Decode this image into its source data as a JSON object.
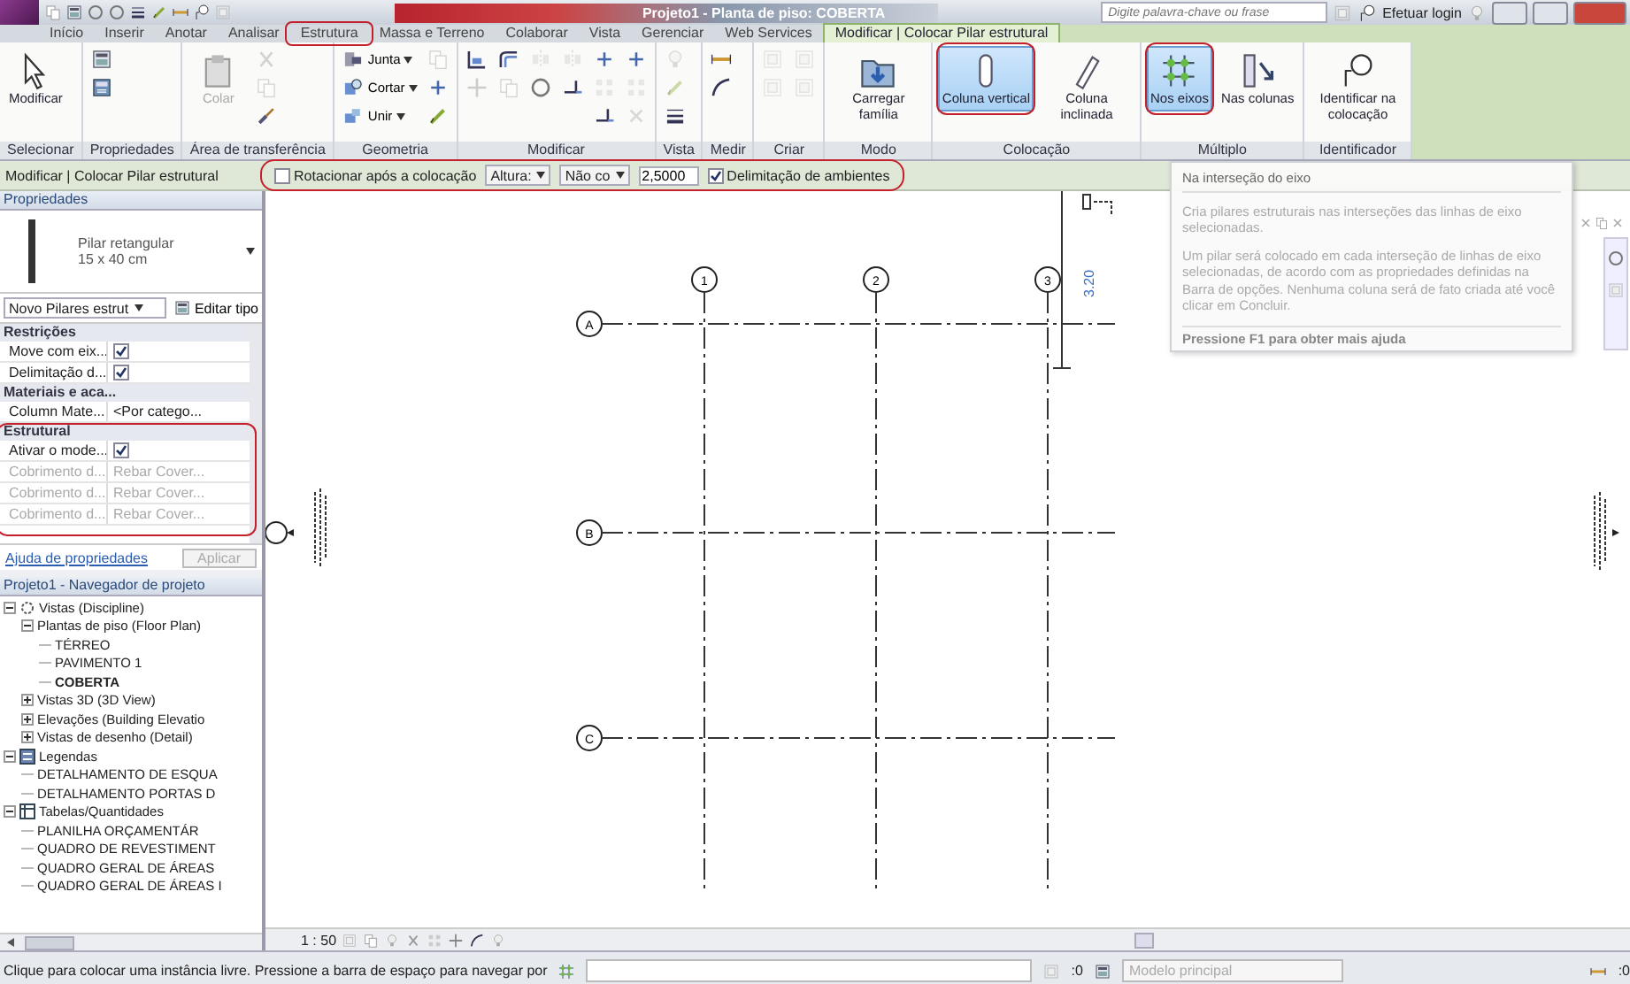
{
  "title_bar": {
    "title": "Projeto1 - Planta de piso: COBERTA",
    "search": {
      "placeholder": "Digite palavra-chave ou frase"
    },
    "login": "Efetuar login"
  },
  "ribbon_tabs": [
    {
      "label": "Início",
      "selected": false,
      "highlighted": false
    },
    {
      "label": "Inserir",
      "selected": false,
      "highlighted": false
    },
    {
      "label": "Anotar",
      "selected": false,
      "highlighted": false
    },
    {
      "label": "Analisar",
      "selected": false,
      "highlighted": false
    },
    {
      "label": "Estrutura",
      "selected": false,
      "highlighted": true
    },
    {
      "label": "Massa e Terreno",
      "selected": false,
      "highlighted": false
    },
    {
      "label": "Colaborar",
      "selected": false,
      "highlighted": false
    },
    {
      "label": "Vista",
      "selected": false,
      "highlighted": false
    },
    {
      "label": "Gerenciar",
      "selected": false,
      "highlighted": false
    },
    {
      "label": "Web Services",
      "selected": false,
      "highlighted": false
    },
    {
      "label": "Modificar | Colocar Pilar estrutural",
      "selected": true,
      "highlighted": false
    }
  ],
  "ribbon_panels": [
    {
      "label": "Selecionar",
      "columns": [
        {
          "kind": "large",
          "label": "Modificar",
          "disabled": false,
          "selected": false,
          "highlighted": false
        }
      ]
    },
    {
      "label": "Propriedades",
      "columns": [
        {
          "kind": "stack",
          "items": [
            {
              "disabled": false
            },
            {
              "disabled": false
            }
          ]
        }
      ]
    },
    {
      "label": "Área de transferência",
      "columns": [
        {
          "kind": "large",
          "label": "Colar",
          "disabled": true,
          "selected": false,
          "highlighted": false
        },
        {
          "kind": "stack",
          "items": [
            {
              "disabled": true
            },
            {
              "disabled": true
            },
            {
              "disabled": false
            }
          ]
        }
      ]
    },
    {
      "label": "Geometria",
      "columns": [
        {
          "kind": "stack",
          "items": [
            {
              "label": "Junta",
              "disabled": false
            },
            {
              "label": "Cortar",
              "disabled": false
            },
            {
              "label": "Unir",
              "disabled": false
            }
          ]
        },
        {
          "kind": "stack",
          "items": [
            {
              "disabled": true
            },
            {
              "disabled": false
            },
            {
              "disabled": false
            }
          ]
        }
      ]
    },
    {
      "label": "Modificar",
      "columns": [
        {
          "kind": "stack",
          "items": [
            {
              "disabled": false
            },
            {
              "disabled": true
            }
          ]
        },
        {
          "kind": "stack",
          "items": [
            {
              "disabled": false
            },
            {
              "disabled": true
            }
          ]
        },
        {
          "kind": "stack",
          "items": [
            {
              "disabled": true
            },
            {
              "disabled": false
            }
          ]
        },
        {
          "kind": "stack",
          "items": [
            {
              "disabled": true
            },
            {
              "disabled": false
            }
          ]
        },
        {
          "kind": "stack",
          "items": [
            {
              "disabled": false
            },
            {
              "disabled": true
            },
            {
              "disabled": false
            }
          ]
        },
        {
          "kind": "stack",
          "items": [
            {
              "disabled": false
            },
            {
              "disabled": true
            },
            {
              "disabled": true
            }
          ]
        }
      ]
    },
    {
      "label": "Vista",
      "columns": [
        {
          "kind": "stack",
          "items": [
            {
              "disabled": true
            },
            {
              "disabled": true
            },
            {
              "disabled": false
            }
          ]
        }
      ]
    },
    {
      "label": "Medir",
      "columns": [
        {
          "kind": "stack",
          "items": [
            {
              "disabled": false
            },
            {
              "disabled": false
            }
          ]
        }
      ]
    },
    {
      "label": "Criar",
      "columns": [
        {
          "kind": "stack",
          "items": [
            {
              "disabled": true
            },
            {
              "disabled": true
            }
          ]
        },
        {
          "kind": "stack",
          "items": [
            {
              "disabled": true
            },
            {
              "disabled": true
            }
          ]
        }
      ]
    },
    {
      "label": "Modo",
      "columns": [
        {
          "kind": "large",
          "label": "Carregar família",
          "disabled": false,
          "selected": false,
          "highlighted": false
        }
      ]
    },
    {
      "label": "Colocação",
      "columns": [
        {
          "kind": "large",
          "label": "Coluna vertical",
          "disabled": false,
          "selected": true,
          "highlighted": true
        },
        {
          "kind": "large",
          "label": "Coluna inclinada",
          "disabled": false,
          "selected": false,
          "highlighted": false
        }
      ]
    },
    {
      "label": "Múltiplo",
      "columns": [
        {
          "kind": "large",
          "label": "Nos eixos",
          "disabled": false,
          "selected": true,
          "highlighted": true
        },
        {
          "kind": "large",
          "label": "Nas colunas",
          "disabled": false,
          "selected": false,
          "highlighted": false
        }
      ]
    },
    {
      "label": "Identificador",
      "columns": [
        {
          "kind": "large",
          "label": "Identificar na colocação",
          "disabled": false,
          "selected": false,
          "highlighted": false
        }
      ]
    }
  ],
  "options_bar": {
    "context": "Modificar | Colocar Pilar estrutural",
    "highlighted": true,
    "rotate": {
      "label": "Rotacionar após a colocação",
      "checked": false
    },
    "height_mode": "Altura:",
    "level": "Não co",
    "height_value": "2,5000",
    "room_bounding": {
      "label": "Delimitação de ambientes",
      "checked": true
    }
  },
  "properties": {
    "title": "Propriedades",
    "type_name": "Pilar retangular",
    "type_size": "15 x 40 cm",
    "type_selector": "Novo Pilares estrut",
    "edit_type": "Editar tipo",
    "groups": [
      {
        "name": "Restrições",
        "highlighted": false,
        "rows": [
          {
            "kind": "check",
            "name": "Move com eix...",
            "checked": true,
            "disabled": false
          },
          {
            "kind": "check",
            "name": "Delimitação d...",
            "checked": true,
            "disabled": false
          }
        ]
      },
      {
        "name": "Materiais e aca...",
        "highlighted": false,
        "rows": [
          {
            "kind": "text",
            "name": "Column Mate...",
            "value": "<Por catego...",
            "disabled": false
          }
        ]
      },
      {
        "name": "Estrutural",
        "highlighted": true,
        "rows": [
          {
            "kind": "check",
            "name": "Ativar o mode...",
            "checked": true,
            "disabled": false
          },
          {
            "kind": "text",
            "name": "Cobrimento d...",
            "value": "Rebar Cover...",
            "disabled": true
          },
          {
            "kind": "text",
            "name": "Cobrimento d...",
            "value": "Rebar Cover...",
            "disabled": true
          },
          {
            "kind": "text",
            "name": "Cobrimento d...",
            "value": "Rebar Cover...",
            "disabled": true
          }
        ]
      }
    ],
    "help_link": "Ajuda de propriedades",
    "apply": {
      "label": "Aplicar",
      "disabled": true
    }
  },
  "project_browser": {
    "title": "Projeto1 - Navegador de projeto",
    "tree": [
      {
        "label": "Vistas (Discipline)",
        "kind": "views",
        "expanded": true,
        "children": [
          {
            "label": "Plantas de piso (Floor Plan)",
            "kind": "folder",
            "expanded": true,
            "children": [
              {
                "label": "TÉRREO",
                "kind": "leaf",
                "selected": false
              },
              {
                "label": "PAVIMENTO 1",
                "kind": "leaf",
                "selected": false
              },
              {
                "label": "COBERTA",
                "kind": "leaf",
                "selected": true
              }
            ]
          },
          {
            "label": "Vistas 3D (3D View)",
            "kind": "folder",
            "expanded": false
          },
          {
            "label": "Elevações (Building Elevatio",
            "kind": "folder",
            "expanded": false
          },
          {
            "label": "Vistas de desenho (Detail)",
            "kind": "folder",
            "expanded": false
          }
        ]
      },
      {
        "label": "Legendas",
        "kind": "legends",
        "expanded": true,
        "children": [
          {
            "label": "DETALHAMENTO DE ESQUA",
            "kind": "leaf",
            "selected": false
          },
          {
            "label": "DETALHAMENTO PORTAS D",
            "kind": "leaf",
            "selected": false
          }
        ]
      },
      {
        "label": "Tabelas/Quantidades",
        "kind": "schedules",
        "expanded": true,
        "children": [
          {
            "label": "PLANILHA ORÇAMENTÁR",
            "kind": "leaf",
            "selected": false
          },
          {
            "label": "QUADRO DE REVESTIMENT",
            "kind": "leaf",
            "selected": false
          },
          {
            "label": "QUADRO GERAL DE ÁREAS",
            "kind": "leaf",
            "selected": false
          },
          {
            "label": "QUADRO GERAL DE ÁREAS I",
            "kind": "leaf",
            "selected": false
          }
        ]
      }
    ]
  },
  "canvas": {
    "grid_columns": [
      "1",
      "2",
      "3"
    ],
    "grid_rows": [
      "A",
      "B",
      "C"
    ],
    "dimension": "3.20"
  },
  "tooltip": {
    "title": "Na interseção do eixo",
    "summary": "Cria pilares estruturais nas interseções das linhas de eixo selecionadas.",
    "detail": "Um pilar será colocado em cada interseção de linhas de eixo selecionadas, de acordo com as propriedades definidas na Barra de opções. Nenhuma coluna será de fato criada até você clicar em Concluir.",
    "help": "Pressione F1 para obter mais ajuda"
  },
  "view_bar": {
    "scale": "1 : 50"
  },
  "status_bar": {
    "message": "Clique para colocar uma instância livre. Pressione a barra de espaço para navegar por",
    "workset_count": ":0",
    "model": "Modelo principal",
    "filter_count": ":0"
  }
}
